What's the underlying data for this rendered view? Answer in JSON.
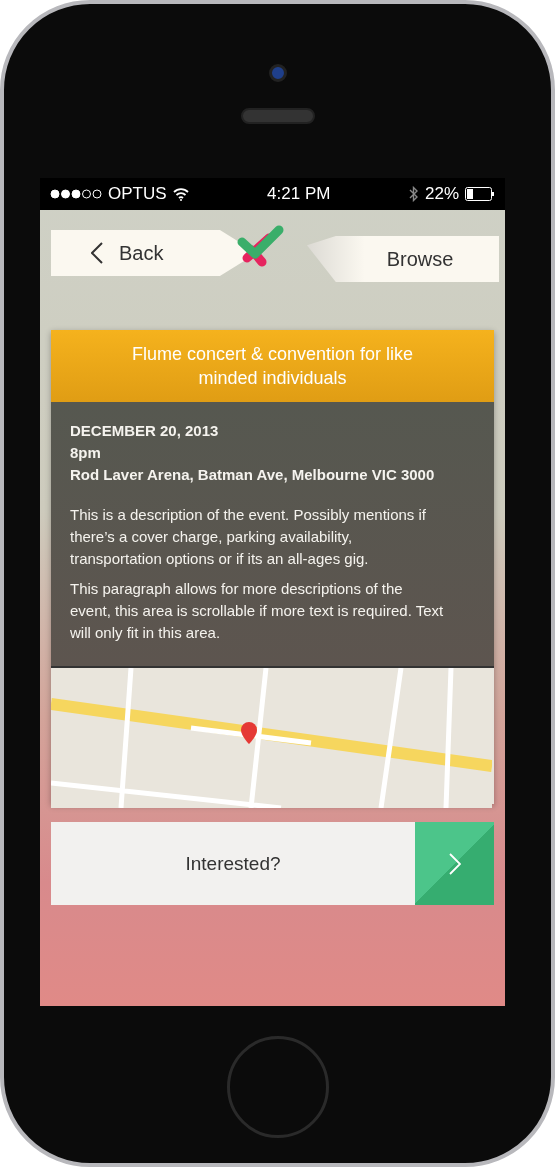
{
  "status_bar": {
    "carrier": "OPTUS",
    "time": "4:21 PM",
    "battery": "22%"
  },
  "nav": {
    "back": "Back",
    "browse": "Browse"
  },
  "event": {
    "title": "Flume concert & convention for like minded individuals",
    "date": "DECEMBER 20, 2013",
    "time": "8pm",
    "venue": "Rod Laver Arena, Batman Ave, Melbourne VIC 3000",
    "paragraphs": [
      "This is a description of the event. Possibly mentions if there’s a cover charge, parking availability, transportation options or if its an all-ages gig.",
      "This paragraph allows for more descriptions of the event, this area is scrollable if more text is required. Text will only fit in this area."
    ]
  },
  "action": {
    "label": "Interested?"
  }
}
